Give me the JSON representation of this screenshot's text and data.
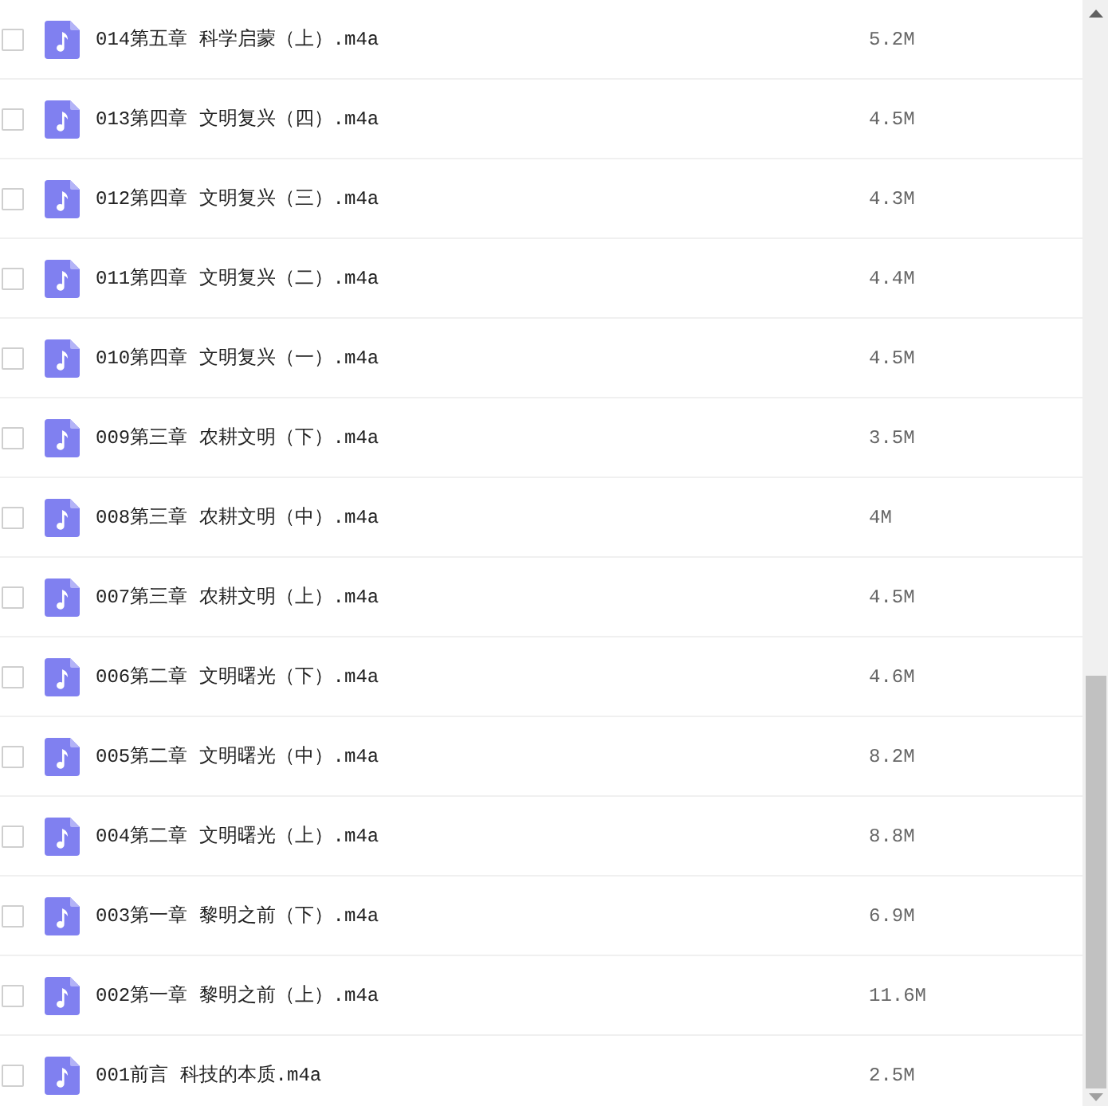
{
  "files": [
    {
      "name": "014第五章 科学启蒙（上）.m4a",
      "size": "5.2M",
      "checked": false
    },
    {
      "name": "013第四章 文明复兴（四）.m4a",
      "size": "4.5M",
      "checked": false
    },
    {
      "name": "012第四章 文明复兴（三）.m4a",
      "size": "4.3M",
      "checked": false
    },
    {
      "name": "011第四章 文明复兴（二）.m4a",
      "size": "4.4M",
      "checked": false
    },
    {
      "name": "010第四章 文明复兴（一）.m4a",
      "size": "4.5M",
      "checked": false
    },
    {
      "name": "009第三章 农耕文明（下）.m4a",
      "size": "3.5M",
      "checked": false
    },
    {
      "name": "008第三章 农耕文明（中）.m4a",
      "size": "4M",
      "checked": false
    },
    {
      "name": "007第三章 农耕文明（上）.m4a",
      "size": "4.5M",
      "checked": false
    },
    {
      "name": "006第二章 文明曙光（下）.m4a",
      "size": "4.6M",
      "checked": false
    },
    {
      "name": "005第二章 文明曙光（中）.m4a",
      "size": "8.2M",
      "checked": false
    },
    {
      "name": "004第二章 文明曙光（上）.m4a",
      "size": "8.8M",
      "checked": false
    },
    {
      "name": "003第一章 黎明之前（下）.m4a",
      "size": "6.9M",
      "checked": false
    },
    {
      "name": "002第一章 黎明之前（上）.m4a",
      "size": "11.6M",
      "checked": false
    },
    {
      "name": "001前言 科技的本质.m4a",
      "size": "2.5M",
      "checked": false
    }
  ]
}
